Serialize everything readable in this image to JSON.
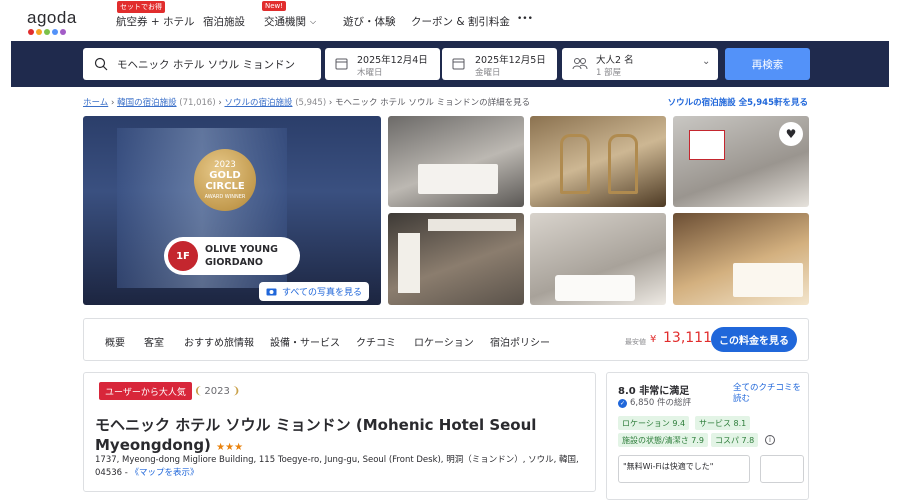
{
  "header": {
    "logo": "agoda",
    "logo_colors": [
      "#e12d2d",
      "#f6a623",
      "#7cc24a",
      "#5392f9",
      "#a35cc7"
    ],
    "nav": [
      {
        "label": "航空券 + ホテル",
        "badge": "セットでお得"
      },
      {
        "label": "宿泊施設",
        "badge": ""
      },
      {
        "label": "交通機関",
        "badge": "New!"
      },
      {
        "label": "遊び・体験",
        "badge": ""
      },
      {
        "label": "クーポン & 割引料金",
        "badge": ""
      }
    ],
    "more": "•••"
  },
  "search": {
    "destination": "モヘニック ホテル ソウル ミョンドン",
    "checkin_date": "2025年12月4日",
    "checkin_day": "木曜日",
    "checkout_date": "2025年12月5日",
    "checkout_day": "金曜日",
    "guests": "大人2 名",
    "rooms": "1 部屋",
    "button": "再検索",
    "accent": "#5392f9"
  },
  "breadcrumb": {
    "home": "ホーム",
    "korea": "韓国の宿泊施設",
    "korea_count": "(71,016)",
    "seoul": "ソウルの宿泊施設",
    "seoul_count": "(5,945)",
    "current": "モヘニック ホテル ソウル ミョンドンの詳細を見る",
    "right_link": "ソウルの宿泊施設 全5,945軒を見る"
  },
  "gallery": {
    "award_year": "2023",
    "award_line1": "GOLD",
    "award_line2": "CIRCLE",
    "award_sub": "AWARD WINNER",
    "floor": "1F",
    "store1": "OLIVE YOUNG",
    "store2": "GIORDANO",
    "see_all": "すべての写真を見る"
  },
  "tabs": {
    "items": [
      "概要",
      "客室",
      "おすすめ旅情報",
      "設備・サービス",
      "クチコミ",
      "ロケーション",
      "宿泊ポリシー"
    ],
    "price_label": "最安値",
    "currency": "¥",
    "price": "13,111",
    "price_button": "この料金を見る"
  },
  "hotel": {
    "popular_badge": "ユーザーから大人気",
    "award_badge": "2023",
    "name": "モヘニック ホテル ソウル ミョンドン (Mohenic Hotel Seoul Myeongdong)",
    "stars": "★★★",
    "address": "1737, Myeong-dong Migliore Building, 115 Toegye-ro, Jung-gu, Seoul (Front Desk), 明洞（ミョンドン）, ソウル, 韓国, 04536 -",
    "map_link": "《マップを表示》"
  },
  "review": {
    "score": "8.0 非常に満足",
    "count": "6,850 件の総評",
    "all_link": "全てのクチコミを読む",
    "chips": [
      "ロケーション 9.4",
      "サービス 8.1",
      "施設の状態/清潔さ 7.9",
      "コスパ 7.8"
    ],
    "quote": "\"無料Wi-Fiは快適でした\""
  }
}
